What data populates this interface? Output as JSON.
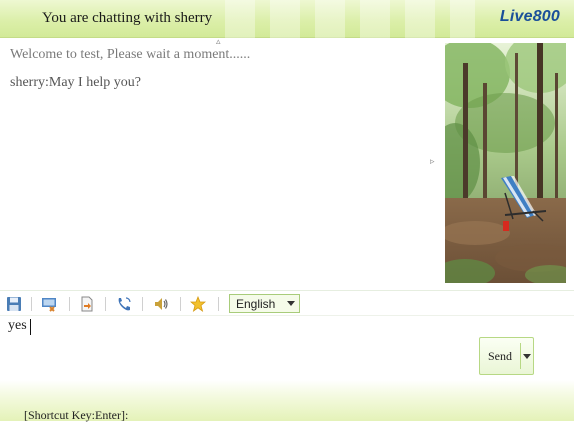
{
  "header": {
    "title": "You are chatting with sherry",
    "logo": "Live800"
  },
  "messages": [
    {
      "text": "Welcome to test, Please wait a moment......"
    },
    {
      "text": "sherry:May I help you?"
    }
  ],
  "side_image": {
    "description_icon": "forest-deckchair-photo"
  },
  "toolbar": {
    "icons": [
      "save-icon",
      "screenshot-icon",
      "send-file-icon",
      "call-icon",
      "sound-icon",
      "favorite-star-icon"
    ],
    "language": {
      "selected": "English"
    }
  },
  "input": {
    "value": "yes"
  },
  "send": {
    "label": "Send"
  },
  "footer": {
    "shortcut_hint": "[Shortcut Key:Enter]:"
  },
  "colors": {
    "header_bg": "#dcefaa",
    "logo": "#1a4f99",
    "accent_border": "#b7d884"
  }
}
